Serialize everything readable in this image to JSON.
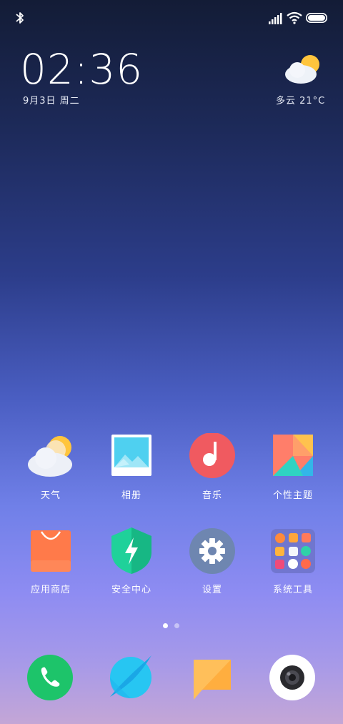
{
  "status_bar": {
    "icons": [
      "bluetooth-icon",
      "signal-icon",
      "wifi-icon",
      "battery-icon"
    ]
  },
  "clock": {
    "time": "02:36",
    "date": "9月3日 周二"
  },
  "weather_widget": {
    "icon": "partly-cloudy-icon",
    "text": "多云 21°C"
  },
  "apps": [
    {
      "label": "天气",
      "icon": "weather-icon"
    },
    {
      "label": "相册",
      "icon": "gallery-icon"
    },
    {
      "label": "音乐",
      "icon": "music-icon"
    },
    {
      "label": "个性主题",
      "icon": "themes-icon"
    },
    {
      "label": "应用商店",
      "icon": "app-store-icon"
    },
    {
      "label": "安全中心",
      "icon": "security-icon"
    },
    {
      "label": "设置",
      "icon": "settings-icon"
    },
    {
      "label": "系统工具",
      "icon": "system-tools-folder-icon"
    }
  ],
  "page_indicator": {
    "count": 2,
    "active": 1
  },
  "dock": [
    {
      "icon": "phone-icon"
    },
    {
      "icon": "browser-icon"
    },
    {
      "icon": "messages-icon"
    },
    {
      "icon": "camera-icon"
    }
  ],
  "colors": {
    "phone": "#1dc46a",
    "browser": "#27c6f2",
    "messages": "#ffb848",
    "music": "#f05a60",
    "security": "#1fd19a",
    "settings_bg": "#6e86b0",
    "app_store": "#ff7a4a"
  }
}
